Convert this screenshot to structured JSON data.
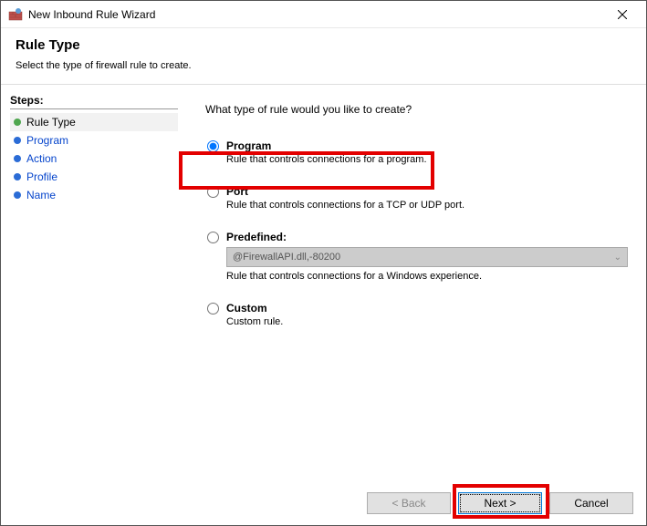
{
  "window": {
    "title": "New Inbound Rule Wizard"
  },
  "header": {
    "title": "Rule Type",
    "subtitle": "Select the type of firewall rule to create."
  },
  "steps": {
    "title": "Steps:",
    "items": [
      {
        "label": "Rule Type",
        "current": true
      },
      {
        "label": "Program",
        "current": false
      },
      {
        "label": "Action",
        "current": false
      },
      {
        "label": "Profile",
        "current": false
      },
      {
        "label": "Name",
        "current": false
      }
    ]
  },
  "content": {
    "question": "What type of rule would you like to create?",
    "options": {
      "program": {
        "label": "Program",
        "desc": "Rule that controls connections for a program."
      },
      "port": {
        "label": "Port",
        "desc": "Rule that controls connections for a TCP or UDP port."
      },
      "predefined": {
        "label": "Predefined:",
        "combo_value": "@FirewallAPI.dll,-80200",
        "desc": "Rule that controls connections for a Windows experience."
      },
      "custom": {
        "label": "Custom",
        "desc": "Custom rule."
      }
    }
  },
  "footer": {
    "back": "< Back",
    "next": "Next >",
    "cancel": "Cancel"
  }
}
